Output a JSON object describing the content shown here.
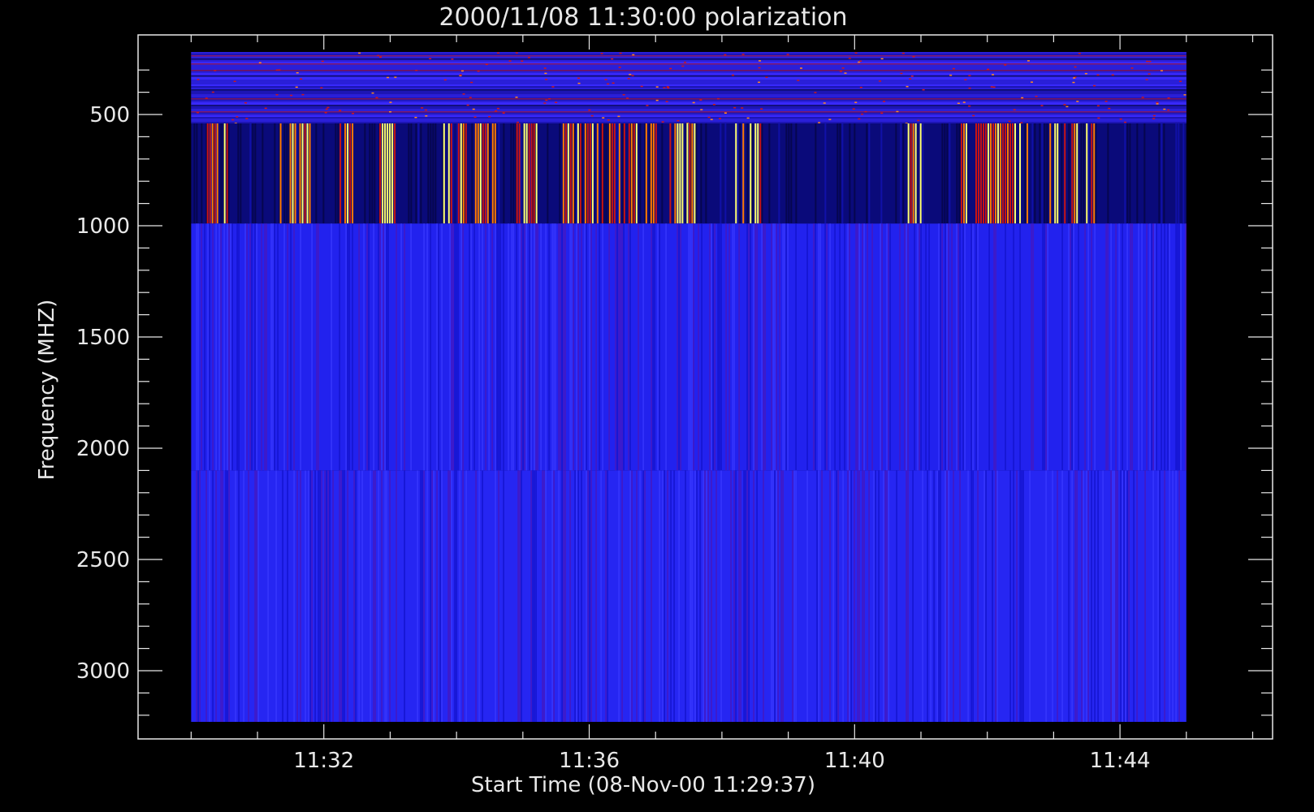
{
  "chart_data": {
    "type": "heatmap",
    "title": "2000/11/08 11:30:00 polarization",
    "xlabel": "Start Time (08-Nov-00 11:29:37)",
    "ylabel": "Frequency (MHZ)",
    "x_range_minutes": [
      29.2,
      46.3
    ],
    "data_x_range_minutes": [
      30.0,
      45.0
    ],
    "y_range_mhz": [
      3000,
      220
    ],
    "y_reversed": true,
    "x_ticks": [
      {
        "label": "11:32",
        "minute": 32
      },
      {
        "label": "11:36",
        "minute": 36
      },
      {
        "label": "11:40",
        "minute": 40
      },
      {
        "label": "11:44",
        "minute": 44
      }
    ],
    "y_ticks": [
      {
        "label": "500",
        "mhz": 500
      },
      {
        "label": "1000",
        "mhz": 1000
      },
      {
        "label": "1500",
        "mhz": 1500
      },
      {
        "label": "2000",
        "mhz": 2000
      },
      {
        "label": "2500",
        "mhz": 2500
      },
      {
        "label": "3000",
        "mhz": 3000
      }
    ],
    "bands": [
      {
        "name": "260-540 MHz",
        "from_mhz": 260,
        "to_mhz": 540,
        "base_color": "#2a1fd8",
        "pattern": "noise-horizontal"
      },
      {
        "name": "540-990 MHz",
        "from_mhz": 540,
        "to_mhz": 990,
        "base_color": "#0a0a7a",
        "pattern": "bursts"
      },
      {
        "name": "990-2100 MHz",
        "from_mhz": 990,
        "to_mhz": 2100,
        "base_color": "#2222ee",
        "pattern": "vertical-stripes"
      },
      {
        "name": "2100-3000 MHz",
        "from_mhz": 2100,
        "to_mhz": 3000,
        "base_color": "#2626f2",
        "pattern": "vertical-stripes"
      }
    ],
    "burst_intervals_minutes": [
      [
        30.2,
        30.6
      ],
      [
        31.3,
        31.8
      ],
      [
        32.2,
        32.5
      ],
      [
        32.8,
        33.1
      ],
      [
        33.8,
        34.6
      ],
      [
        34.9,
        35.3
      ],
      [
        35.6,
        37.0
      ],
      [
        37.1,
        37.6
      ],
      [
        38.2,
        38.6
      ],
      [
        40.8,
        41.0
      ],
      [
        41.6,
        42.6
      ],
      [
        42.9,
        43.6
      ],
      [
        44.8,
        44.9
      ]
    ],
    "colors": {
      "background": "#000000",
      "axis": "#e8e8e8",
      "burst_red": "#c81414",
      "burst_orange": "#ff7a00",
      "burst_yellow": "#ffff70"
    }
  }
}
